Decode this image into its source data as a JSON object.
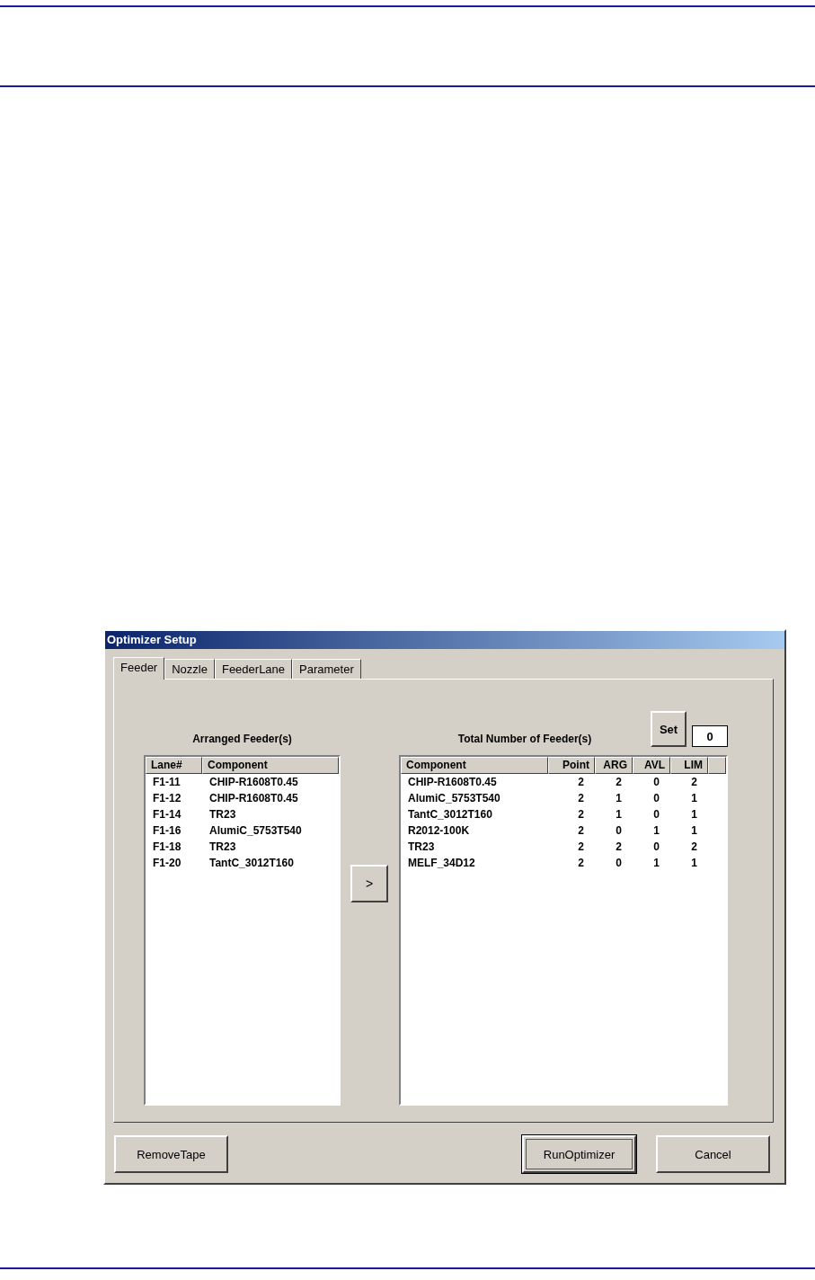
{
  "window": {
    "title": "Optimizer Setup"
  },
  "tabs": [
    {
      "label": "Feeder",
      "selected": true
    },
    {
      "label": "Nozzle",
      "selected": false
    },
    {
      "label": "FeederLane",
      "selected": false
    },
    {
      "label": "Parameter",
      "selected": false
    }
  ],
  "arranged": {
    "label": "Arranged Feeder(s)",
    "columns": [
      "Lane#",
      "Component"
    ],
    "rows": [
      [
        "F1-11",
        "CHIP-R1608T0.45"
      ],
      [
        "F1-12",
        "CHIP-R1608T0.45"
      ],
      [
        "F1-14",
        "TR23"
      ],
      [
        "F1-16",
        "AlumiC_5753T540"
      ],
      [
        "F1-18",
        "TR23"
      ],
      [
        "F1-20",
        "TantC_3012T160"
      ]
    ]
  },
  "move_button": ">",
  "total": {
    "label": "Total Number of Feeder(s)",
    "set_button": "Set",
    "count_value": "0",
    "columns": [
      "Component",
      "Point",
      "ARG",
      "AVL",
      "LIM"
    ],
    "rows": [
      [
        "CHIP-R1608T0.45",
        "2",
        "2",
        "0",
        "2"
      ],
      [
        "AlumiC_5753T540",
        "2",
        "1",
        "0",
        "1"
      ],
      [
        "TantC_3012T160",
        "2",
        "1",
        "0",
        "1"
      ],
      [
        "R2012-100K",
        "2",
        "0",
        "1",
        "1"
      ],
      [
        "TR23",
        "2",
        "2",
        "0",
        "2"
      ],
      [
        "MELF_34D12",
        "2",
        "0",
        "1",
        "1"
      ]
    ]
  },
  "buttons": [
    {
      "label": "RemoveTape",
      "default": false
    },
    {
      "label": "RunOptimizer",
      "default": true
    },
    {
      "label": "Cancel",
      "default": false
    }
  ]
}
